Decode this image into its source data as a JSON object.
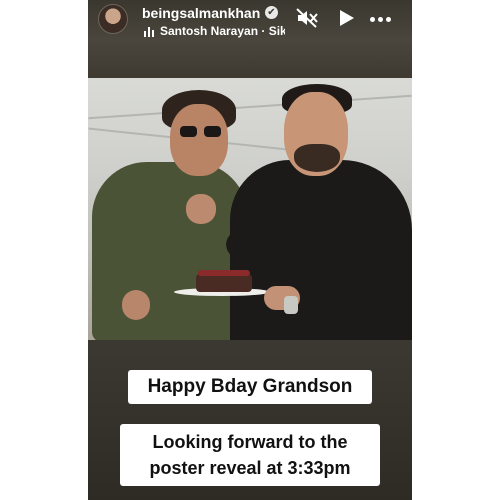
{
  "header": {
    "username": "beingsalmankhan",
    "verified_mark": "✔",
    "music_text": "Santosh Narayan · Sik",
    "icons": [
      "mute-icon",
      "play-icon",
      "more-icon"
    ]
  },
  "photo": {
    "description_icon": "photo-image"
  },
  "stickers": {
    "line1": "Happy Bday Grandson",
    "line2a": "Looking forward to the",
    "line2b": "poster reveal at 3:33pm"
  },
  "colors": {
    "background": "#3b3831",
    "sticker_bg": "#ffffff",
    "text": "#ffffff"
  }
}
